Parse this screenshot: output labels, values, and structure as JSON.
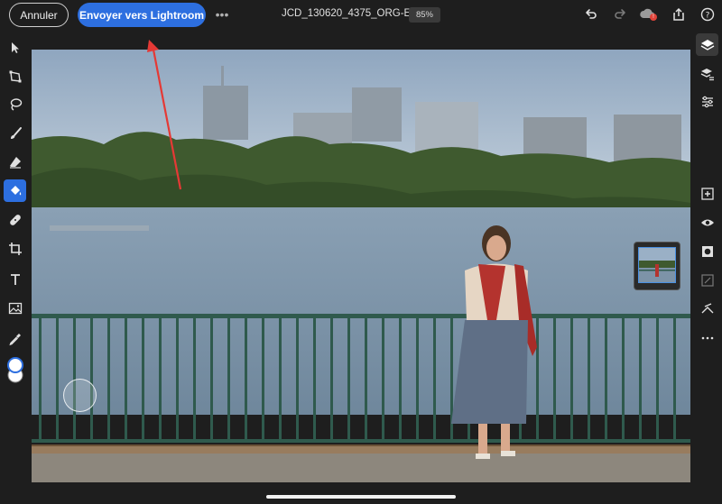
{
  "topbar": {
    "cancel_label": "Annuler",
    "send_label": "Envoyer vers Lightroom",
    "more_label": "•••",
    "document_title": "JCD_130620_4375_ORG-Edit",
    "zoom": "85%",
    "cloud_badge": "!"
  },
  "left_tools": [
    {
      "name": "move-tool",
      "icon": "arrow-pointer-icon"
    },
    {
      "name": "transform-tool",
      "icon": "transform-icon"
    },
    {
      "name": "lasso-tool",
      "icon": "lasso-icon"
    },
    {
      "name": "brush-tool",
      "icon": "brush-icon"
    },
    {
      "name": "eraser-tool",
      "icon": "eraser-icon"
    },
    {
      "name": "fill-tool",
      "icon": "paint-bucket-icon",
      "active": true
    },
    {
      "name": "healing-tool",
      "icon": "bandage-icon"
    },
    {
      "name": "crop-tool",
      "icon": "crop-icon"
    },
    {
      "name": "type-tool",
      "icon": "text-icon"
    },
    {
      "name": "image-tool",
      "icon": "image-icon"
    },
    {
      "name": "eyedropper-tool",
      "icon": "eyedropper-icon"
    },
    {
      "name": "color-swatch",
      "icon": "color-swatch-icon"
    }
  ],
  "right_tools": [
    {
      "name": "layers",
      "icon": "layers-icon"
    },
    {
      "name": "layer-properties",
      "icon": "layer-properties-icon"
    },
    {
      "name": "adjustments",
      "icon": "sliders-icon"
    },
    {
      "name": "add-layer",
      "icon": "plus-square-icon"
    },
    {
      "name": "visibility",
      "icon": "eye-icon"
    },
    {
      "name": "mask",
      "icon": "mask-icon"
    },
    {
      "name": "fill-layer",
      "icon": "fill-layer-icon"
    },
    {
      "name": "clip",
      "icon": "clip-icon"
    },
    {
      "name": "more",
      "icon": "more-icon"
    }
  ],
  "colors": {
    "accent": "#2d6fe0",
    "background": "#1e1e1e",
    "arrow": "#e53935"
  }
}
